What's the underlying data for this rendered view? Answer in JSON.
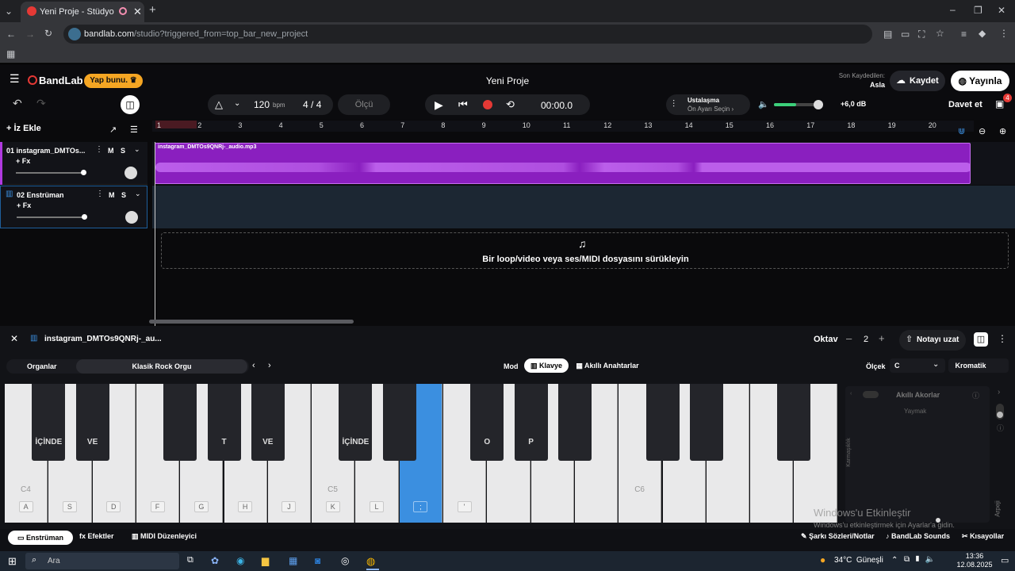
{
  "browser": {
    "tab_title": "Yeni Proje - Stüdyo",
    "url_domain": "bandlab.com",
    "url_path": "/studio?triggered_from=top_bar_new_project"
  },
  "header": {
    "brand": "BandLab",
    "upgrade_label": "Yap bunu.",
    "project_title": "Yeni Proje",
    "last_saved_label": "Son Kaydedilen:",
    "last_saved_value": "Asla",
    "save_label": "Kaydet",
    "publish_label": "Yayınla"
  },
  "toolbar": {
    "bpm_value": "120",
    "bpm_unit": "bpm",
    "time_sig_top": "4",
    "time_sig_bottom": "4",
    "measure_label": "Ölçü",
    "time_display": "00:00.0",
    "mastering_title": "Ustalaşma",
    "mastering_sub": "Ön Ayarı Seçin",
    "volume_db": "+6,0 dB",
    "invite_label": "Davet et",
    "gift_badge": "4"
  },
  "tracks": {
    "add_label": "İz Ekle",
    "items": [
      {
        "name": "01  instagram_DMTOs...",
        "fx": "+ Fx",
        "m": "M",
        "s": "S"
      },
      {
        "name": "02  Enstrüman",
        "fx": "+ Fx",
        "m": "M",
        "s": "S"
      }
    ],
    "clip_name": "instagram_DMTOs9QNRj-_audio.mp3",
    "drop_hint": "Bir loop/video veya ses/MIDI dosyasını sürükleyin"
  },
  "ruler": [
    "1",
    "2",
    "3",
    "4",
    "5",
    "6",
    "7",
    "8",
    "9",
    "10",
    "11",
    "12",
    "13",
    "14",
    "15",
    "16",
    "17",
    "18",
    "19",
    "20"
  ],
  "panel": {
    "title": "instagram_DMTOs9QNRj-_au...",
    "octave_label": "Oktav",
    "octave_value": "2",
    "sustain_label": "Notayı uzat",
    "category": "Organlar",
    "preset": "Klasik Rock Orgu",
    "mode_label": "Mod",
    "mode_keyboard": "Klavye",
    "mode_smart": "Akıllı Anahtarlar",
    "scale_label": "Ölçek",
    "scale_value": "C",
    "scale_type": "Kromatik",
    "smart_chords": "Akıllı Akorlar",
    "play_label": "Yaymak",
    "complexity": "Karmaşıklık",
    "arpeggio": "Arpeji",
    "windows_notice_1": "Windows'u Etkinleştir",
    "windows_notice_2": "Windows'u etkinleştirmek için Ayarlar'a gidin."
  },
  "piano": {
    "white_keys": [
      "A",
      "S",
      "D",
      "F",
      "G",
      "H",
      "J",
      "K",
      "L",
      ";",
      "'",
      "",
      "",
      "",
      "",
      "",
      "",
      "",
      ""
    ],
    "octave_labels": {
      "0": "C4",
      "7": "C5",
      "14": "C6"
    },
    "black_keys": [
      "İÇİNDE",
      "VE",
      "",
      "T",
      "VE",
      "İÇİNDE",
      "",
      "O",
      "P",
      "",
      "",
      "",
      "",
      "",
      "",
      ""
    ]
  },
  "bottom": {
    "instrument_tab": "Enstrüman",
    "effects_tab": "Efektler",
    "midi_tab": "MIDI Düzenleyici",
    "lyrics": "Şarkı Sözleri/Notlar",
    "sounds": "BandLab Sounds",
    "shortcuts": "Kısayollar"
  },
  "taskbar": {
    "search": "Ara",
    "weather": "34°C  Güneşli",
    "time": "13:36",
    "date": "12.08.2025"
  },
  "colors": {
    "accent": "#b03ae0",
    "record": "#e53935",
    "active_key": "#3b8fe0",
    "upgrade": "#f5a623"
  }
}
